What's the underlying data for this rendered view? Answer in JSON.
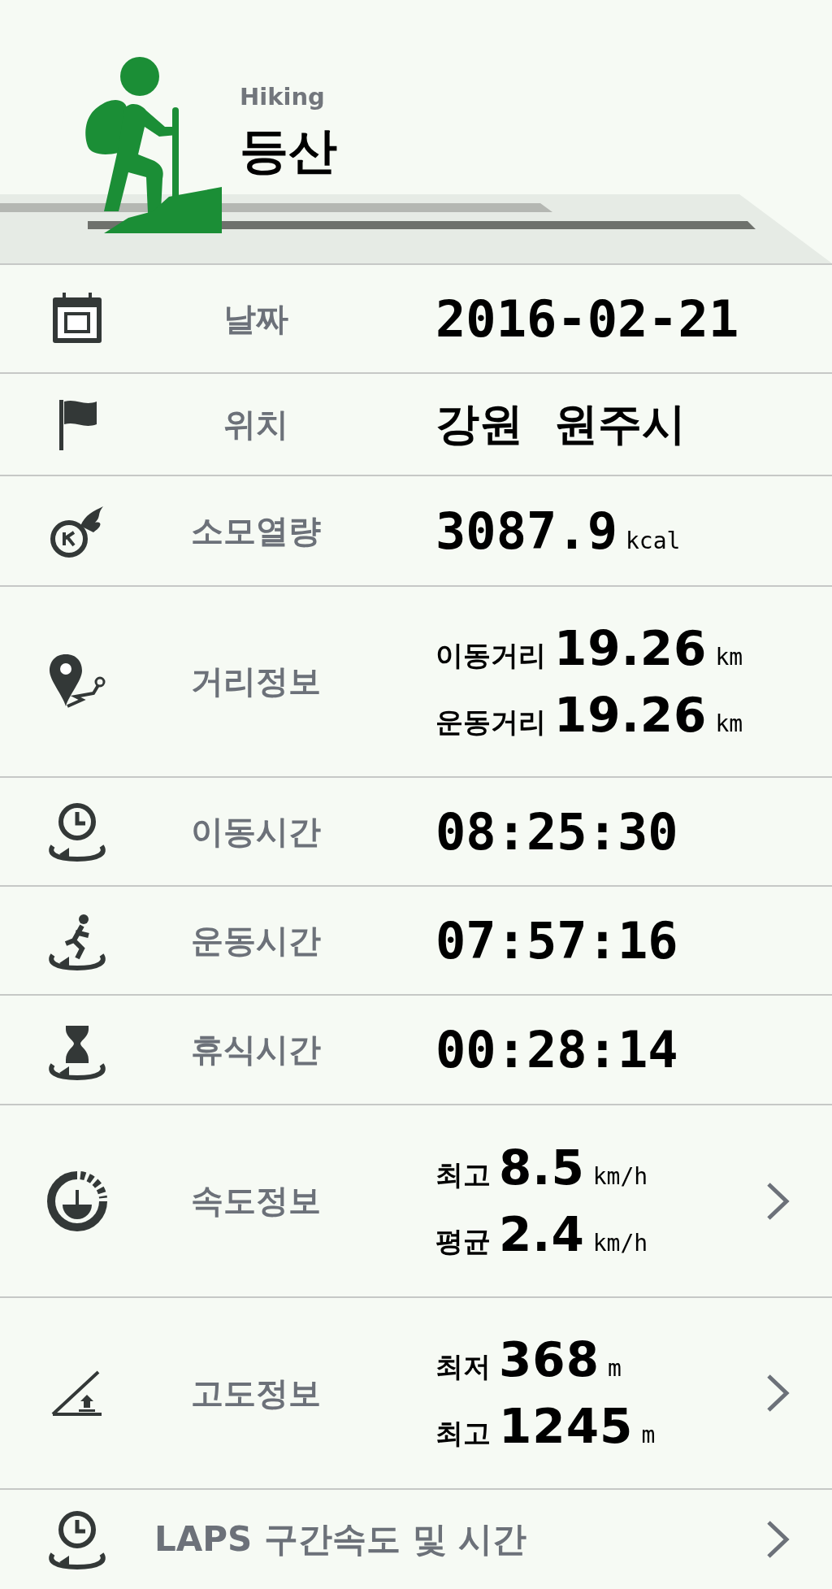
{
  "header": {
    "subtitle": "Hiking",
    "title": "등산"
  },
  "rows": [
    {
      "kind": "value",
      "label": "날짜",
      "value": "2016-02-21",
      "chevron": false
    },
    {
      "kind": "value",
      "label": "위치",
      "value": "강원  원주시",
      "chevron": false
    },
    {
      "kind": "value",
      "label": "소모열량",
      "value": "3087.9",
      "unit": "kcal",
      "chevron": false
    },
    {
      "kind": "lines",
      "label": "거리정보",
      "lines": [
        {
          "caption": "이동거리",
          "value": "19.26",
          "unit": "km"
        },
        {
          "caption": "운동거리",
          "value": "19.26",
          "unit": "km"
        }
      ],
      "chevron": false
    },
    {
      "kind": "value",
      "label": "이동시간",
      "value": "08:25:30",
      "chevron": false
    },
    {
      "kind": "value",
      "label": "운동시간",
      "value": "07:57:16",
      "chevron": false
    },
    {
      "kind": "value",
      "label": "휴식시간",
      "value": "00:28:14",
      "chevron": false
    },
    {
      "kind": "lines",
      "label": "속도정보",
      "lines": [
        {
          "caption": "최고",
          "value": "8.5",
          "unit": "km/h"
        },
        {
          "caption": "평균",
          "value": "2.4",
          "unit": "km/h"
        }
      ],
      "chevron": true
    },
    {
      "kind": "lines",
      "label": "고도정보",
      "lines": [
        {
          "caption": "최저",
          "value": "368",
          "unit": "m"
        },
        {
          "caption": "최고",
          "value": "1245",
          "unit": "m"
        }
      ],
      "chevron": true
    },
    {
      "kind": "wide",
      "label": "LAPS 구간속도 및 시간",
      "chevron": true
    }
  ]
}
